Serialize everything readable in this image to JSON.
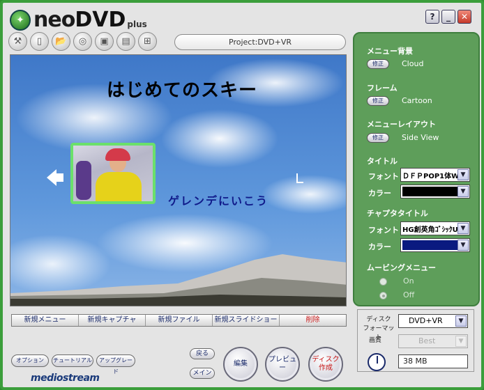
{
  "app": {
    "logo_neo": "neo",
    "logo_dvd": "DVD",
    "logo_plus": "plus",
    "brand": "mediostream"
  },
  "window": {
    "help": "?",
    "minimize": "_",
    "close": "✕"
  },
  "toolbar": {
    "project": "Project:DVD+VR",
    "icons": [
      "wizard-icon",
      "new-document-icon",
      "open-folder-icon",
      "disc-icon",
      "save-icon",
      "save-as-icon",
      "network-icon"
    ]
  },
  "preview": {
    "title": "はじめてのスキー",
    "chapter": "ゲレンデにいこう"
  },
  "actions": {
    "new_menu": "新規メニュー",
    "new_capture": "新規キャプチャ",
    "new_file": "新規ファイル",
    "new_slideshow": "新規スライドショー",
    "delete": "削除"
  },
  "bottom": {
    "option": "オプション",
    "tutorial": "チュートリアル",
    "upgrade": "アップグレード",
    "back": "戻る",
    "main": "メイン",
    "edit": "編集",
    "preview": "プレビュー",
    "create_disc_line1": "ディスク",
    "create_disc_line2": "作成"
  },
  "panel": {
    "menu_bg_label": "メニュー背景",
    "menu_bg_value": "Cloud",
    "frame_label": "フレーム",
    "frame_value": "Cartoon",
    "layout_label": "メニューレイアウト",
    "layout_value": "Side View",
    "fix_label": "修正",
    "title_label": "タイトル",
    "font_label": "フォント",
    "color_label": "カラー",
    "title_font": "ＤＦＰPOP1体W",
    "title_color": "#000000",
    "chapter_title_label": "チャプタタイトル",
    "chapter_font": "HG創英角ｺﾞｼｯｸUB",
    "chapter_color": "#0a1a80",
    "moving_menu_label": "ムービングメニュー",
    "on_label": "On",
    "off_label": "Off",
    "arrow": "▼"
  },
  "disc": {
    "format_label_line1": "ディスク",
    "format_label_line2": "フォーマット",
    "format_value": "DVD+VR",
    "quality_label": "画質",
    "quality_value": "Best",
    "size_value": "38 MB"
  }
}
